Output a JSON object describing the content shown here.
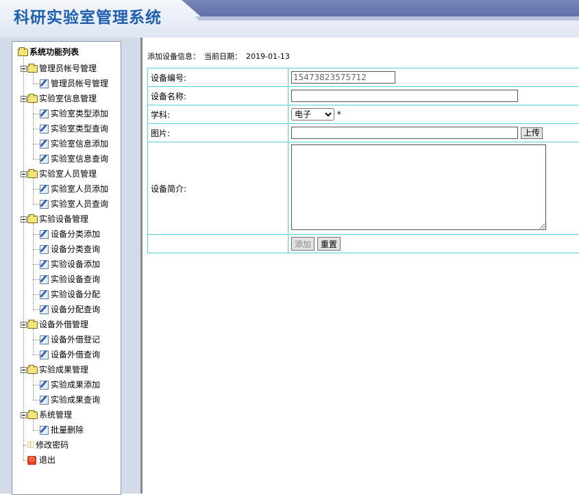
{
  "header": {
    "title": "科研实验室管理系统"
  },
  "sidebar": {
    "root_label": "系统功能列表",
    "groups": [
      {
        "label": "管理员帐号管理",
        "items": [
          "管理员帐号管理"
        ]
      },
      {
        "label": "实验室信息管理",
        "items": [
          "实验室类型添加",
          "实验室类型查询",
          "实验室信息添加",
          "实验室信息查询"
        ]
      },
      {
        "label": "实验室人员管理",
        "items": [
          "实验室人员添加",
          "实验室人员查询"
        ]
      },
      {
        "label": "实验设备管理",
        "items": [
          "设备分类添加",
          "设备分类查询",
          "实验设备添加",
          "实验设备查询",
          "实验设备分配",
          "设备分配查询"
        ]
      },
      {
        "label": "设备外借管理",
        "items": [
          "设备外借登记",
          "设备外借查询"
        ]
      },
      {
        "label": "实验成果管理",
        "items": [
          "实验成果添加",
          "实验成果查询"
        ]
      },
      {
        "label": "系统管理",
        "items": [
          "批量删除"
        ]
      }
    ],
    "change_password": "修改密码",
    "logout": "退出"
  },
  "main": {
    "info_label": "添加设备信息：",
    "date_label": "当前日期：",
    "date_value": "2019-01-13",
    "form": {
      "device_id_label": "设备编号:",
      "device_id_value": "15473823575712",
      "device_name_label": "设备名称:",
      "device_name_value": "",
      "subject_label": "学科:",
      "subject_value": "电子",
      "required_mark": "*",
      "image_label": "图片:",
      "image_value": "",
      "upload_button": "上传",
      "description_label": "设备简介:",
      "description_value": "",
      "add_button": "添加",
      "reset_button": "重置"
    }
  }
}
